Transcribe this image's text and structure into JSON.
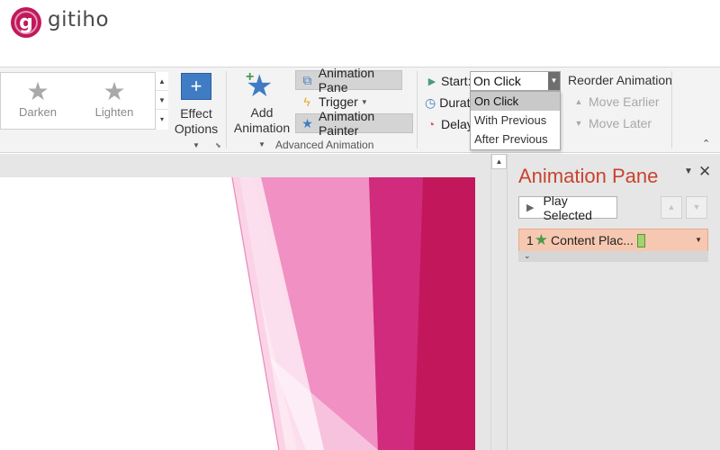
{
  "logo": {
    "letter": "g",
    "text": "gitiho"
  },
  "effects_gallery": [
    {
      "label": "Darken",
      "icon": "star-outline-icon"
    },
    {
      "label": "Lighten",
      "icon": "star-outline-icon"
    }
  ],
  "effect_options": {
    "line1": "Effect",
    "line2": "Options"
  },
  "advanced": {
    "add_animation": {
      "line1": "Add",
      "line2": "Animation"
    },
    "animation_pane": "Animation Pane",
    "trigger": "Trigger",
    "animation_painter": "Animation Painter",
    "group_label": "Advanced Animation"
  },
  "timing": {
    "start_label": "Start:",
    "start_value": "On Click",
    "duration_label": "Durati",
    "delay_label": "Delay",
    "dropdown_options": [
      "On Click",
      "With Previous",
      "After Previous"
    ]
  },
  "reorder": {
    "title": "Reorder Animation",
    "move_earlier": "Move Earlier",
    "move_later": "Move Later"
  },
  "pane": {
    "title": "Animation Pane",
    "play_selected": "Play Selected",
    "item": {
      "index": "1",
      "label": "Content Plac..."
    }
  },
  "colors": {
    "brand": "#c2185b",
    "pane_title": "#c8432e",
    "item_highlight": "#f7c8b1",
    "slide_pink_dark": "#c2185b",
    "slide_pink_light": "#f48fc1"
  }
}
